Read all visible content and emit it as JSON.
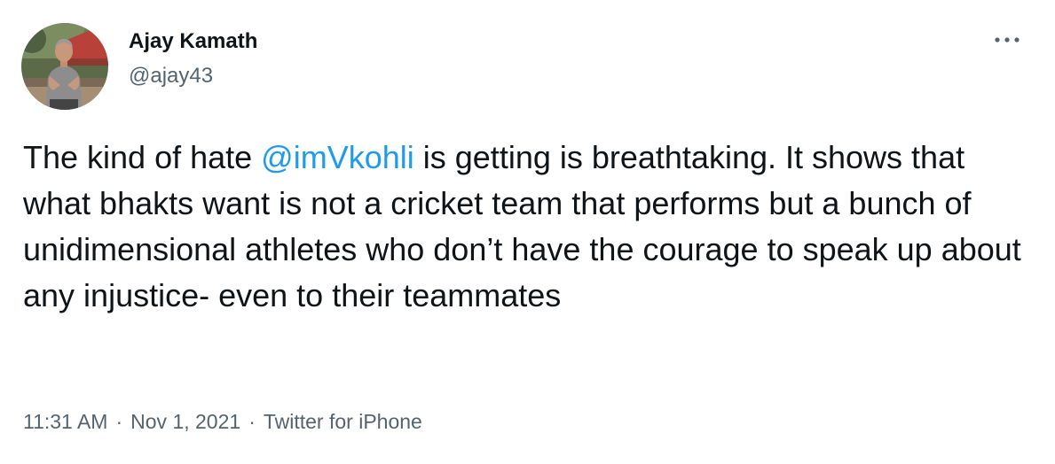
{
  "author": {
    "display_name": "Ajay Kamath",
    "handle": "@ajay43"
  },
  "more_icon": "more-horizontal-icon",
  "tweet": {
    "text_before": "The kind of hate ",
    "mention": "@imVkohli",
    "text_after": " is getting is breathtaking. It shows that what bhakts want is not a cricket team that performs but a bunch of unidimensional athletes who don’t have the courage to speak up about any injustice- even to their teammates"
  },
  "meta": {
    "time": "11:31 AM",
    "separator": "·",
    "date": "Nov 1, 2021",
    "source": "Twitter for iPhone"
  },
  "colors": {
    "text": "#0f1419",
    "secondary": "#536471",
    "link": "#1d9bf0"
  }
}
